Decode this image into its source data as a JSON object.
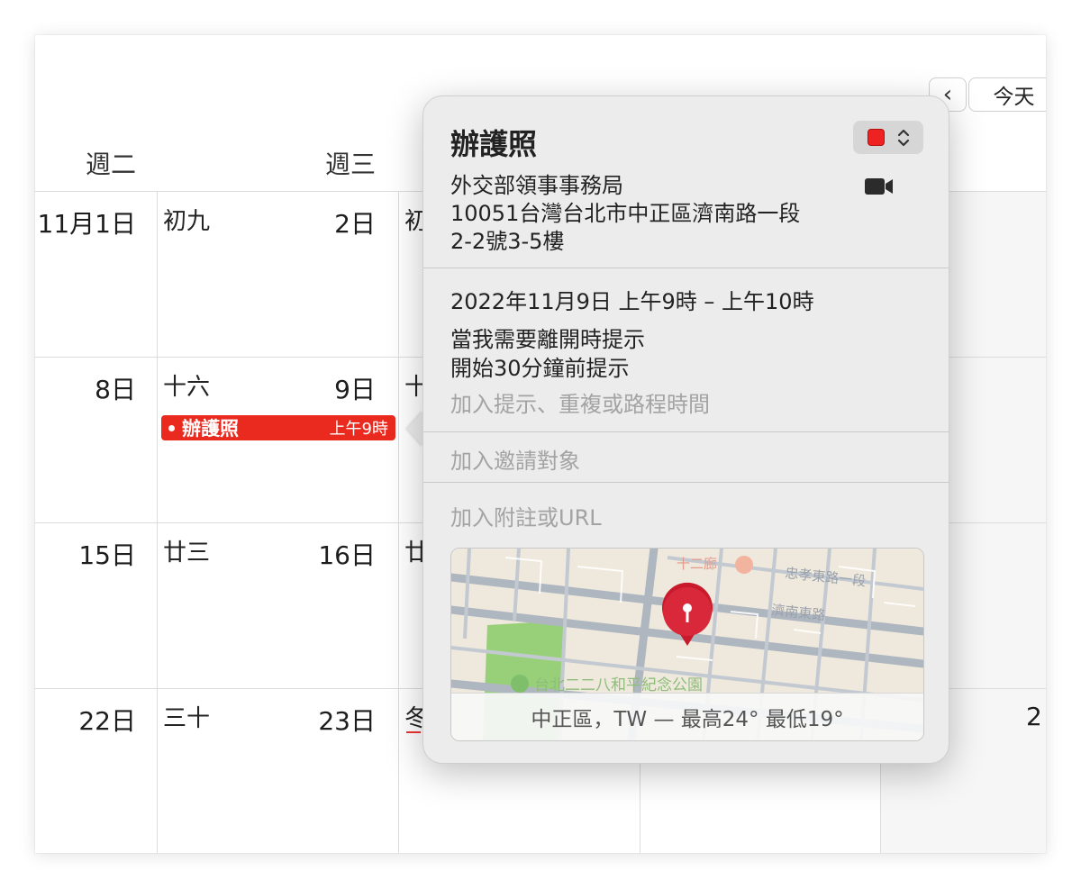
{
  "toolbar": {
    "prev_label": "‹",
    "today_label": "今天"
  },
  "weekdays": [
    "週二",
    "週三"
  ],
  "weeks": [
    {
      "tue_date": "11月1日",
      "tue_lunar": "初九",
      "wed_date": "2日",
      "wed_lunar": "初"
    },
    {
      "tue_date": "8日",
      "tue_lunar": "十六",
      "wed_date": "9日",
      "wed_lunar": "十"
    },
    {
      "tue_date": "15日",
      "tue_lunar": "廿三",
      "wed_date": "16日",
      "wed_lunar": "廿"
    },
    {
      "tue_date": "22日",
      "tue_lunar": "三十",
      "wed_date": "23日",
      "wed_lunar": "冬",
      "sat_date": "2"
    }
  ],
  "event": {
    "title": "辦護照",
    "time": "上午9時",
    "color": "#ea2a1e"
  },
  "popover": {
    "title": "辦護照",
    "calendar_color": "#ee2222",
    "location_line1": "外交部領事事務局",
    "location_line2": "10051台灣台北市中正區濟南路一段",
    "location_line3": "2-2號3-5樓",
    "datetime": "2022年11月9日  上午9時 – 上午10時",
    "alert1": "當我需要離開時提示",
    "alert2": "開始30分鐘前提示",
    "add_alert": "加入提示、重複或路程時間",
    "add_invitees": "加入邀請對象",
    "add_notes": "加入附註或URL",
    "map": {
      "labels": [
        "十二廊",
        "忠孝東路一段",
        "濟南東路",
        "台北二二八和平紀念公園"
      ],
      "weather": "中正區，TW — 最高24° 最低19°"
    }
  }
}
